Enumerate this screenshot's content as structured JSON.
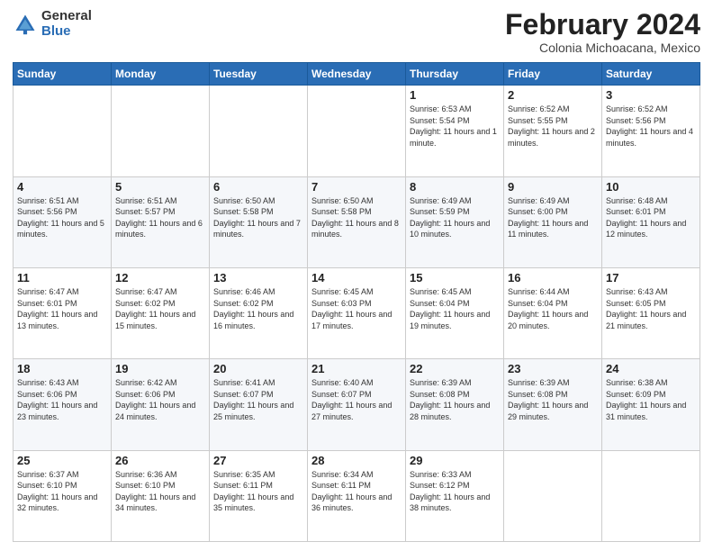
{
  "logo": {
    "general": "General",
    "blue": "Blue"
  },
  "header": {
    "month": "February 2024",
    "location": "Colonia Michoacana, Mexico"
  },
  "weekdays": [
    "Sunday",
    "Monday",
    "Tuesday",
    "Wednesday",
    "Thursday",
    "Friday",
    "Saturday"
  ],
  "weeks": [
    [
      {
        "day": "",
        "info": ""
      },
      {
        "day": "",
        "info": ""
      },
      {
        "day": "",
        "info": ""
      },
      {
        "day": "",
        "info": ""
      },
      {
        "day": "1",
        "info": "Sunrise: 6:53 AM\nSunset: 5:54 PM\nDaylight: 11 hours and 1 minute."
      },
      {
        "day": "2",
        "info": "Sunrise: 6:52 AM\nSunset: 5:55 PM\nDaylight: 11 hours and 2 minutes."
      },
      {
        "day": "3",
        "info": "Sunrise: 6:52 AM\nSunset: 5:56 PM\nDaylight: 11 hours and 4 minutes."
      }
    ],
    [
      {
        "day": "4",
        "info": "Sunrise: 6:51 AM\nSunset: 5:56 PM\nDaylight: 11 hours and 5 minutes."
      },
      {
        "day": "5",
        "info": "Sunrise: 6:51 AM\nSunset: 5:57 PM\nDaylight: 11 hours and 6 minutes."
      },
      {
        "day": "6",
        "info": "Sunrise: 6:50 AM\nSunset: 5:58 PM\nDaylight: 11 hours and 7 minutes."
      },
      {
        "day": "7",
        "info": "Sunrise: 6:50 AM\nSunset: 5:58 PM\nDaylight: 11 hours and 8 minutes."
      },
      {
        "day": "8",
        "info": "Sunrise: 6:49 AM\nSunset: 5:59 PM\nDaylight: 11 hours and 10 minutes."
      },
      {
        "day": "9",
        "info": "Sunrise: 6:49 AM\nSunset: 6:00 PM\nDaylight: 11 hours and 11 minutes."
      },
      {
        "day": "10",
        "info": "Sunrise: 6:48 AM\nSunset: 6:01 PM\nDaylight: 11 hours and 12 minutes."
      }
    ],
    [
      {
        "day": "11",
        "info": "Sunrise: 6:47 AM\nSunset: 6:01 PM\nDaylight: 11 hours and 13 minutes."
      },
      {
        "day": "12",
        "info": "Sunrise: 6:47 AM\nSunset: 6:02 PM\nDaylight: 11 hours and 15 minutes."
      },
      {
        "day": "13",
        "info": "Sunrise: 6:46 AM\nSunset: 6:02 PM\nDaylight: 11 hours and 16 minutes."
      },
      {
        "day": "14",
        "info": "Sunrise: 6:45 AM\nSunset: 6:03 PM\nDaylight: 11 hours and 17 minutes."
      },
      {
        "day": "15",
        "info": "Sunrise: 6:45 AM\nSunset: 6:04 PM\nDaylight: 11 hours and 19 minutes."
      },
      {
        "day": "16",
        "info": "Sunrise: 6:44 AM\nSunset: 6:04 PM\nDaylight: 11 hours and 20 minutes."
      },
      {
        "day": "17",
        "info": "Sunrise: 6:43 AM\nSunset: 6:05 PM\nDaylight: 11 hours and 21 minutes."
      }
    ],
    [
      {
        "day": "18",
        "info": "Sunrise: 6:43 AM\nSunset: 6:06 PM\nDaylight: 11 hours and 23 minutes."
      },
      {
        "day": "19",
        "info": "Sunrise: 6:42 AM\nSunset: 6:06 PM\nDaylight: 11 hours and 24 minutes."
      },
      {
        "day": "20",
        "info": "Sunrise: 6:41 AM\nSunset: 6:07 PM\nDaylight: 11 hours and 25 minutes."
      },
      {
        "day": "21",
        "info": "Sunrise: 6:40 AM\nSunset: 6:07 PM\nDaylight: 11 hours and 27 minutes."
      },
      {
        "day": "22",
        "info": "Sunrise: 6:39 AM\nSunset: 6:08 PM\nDaylight: 11 hours and 28 minutes."
      },
      {
        "day": "23",
        "info": "Sunrise: 6:39 AM\nSunset: 6:08 PM\nDaylight: 11 hours and 29 minutes."
      },
      {
        "day": "24",
        "info": "Sunrise: 6:38 AM\nSunset: 6:09 PM\nDaylight: 11 hours and 31 minutes."
      }
    ],
    [
      {
        "day": "25",
        "info": "Sunrise: 6:37 AM\nSunset: 6:10 PM\nDaylight: 11 hours and 32 minutes."
      },
      {
        "day": "26",
        "info": "Sunrise: 6:36 AM\nSunset: 6:10 PM\nDaylight: 11 hours and 34 minutes."
      },
      {
        "day": "27",
        "info": "Sunrise: 6:35 AM\nSunset: 6:11 PM\nDaylight: 11 hours and 35 minutes."
      },
      {
        "day": "28",
        "info": "Sunrise: 6:34 AM\nSunset: 6:11 PM\nDaylight: 11 hours and 36 minutes."
      },
      {
        "day": "29",
        "info": "Sunrise: 6:33 AM\nSunset: 6:12 PM\nDaylight: 11 hours and 38 minutes."
      },
      {
        "day": "",
        "info": ""
      },
      {
        "day": "",
        "info": ""
      }
    ]
  ]
}
